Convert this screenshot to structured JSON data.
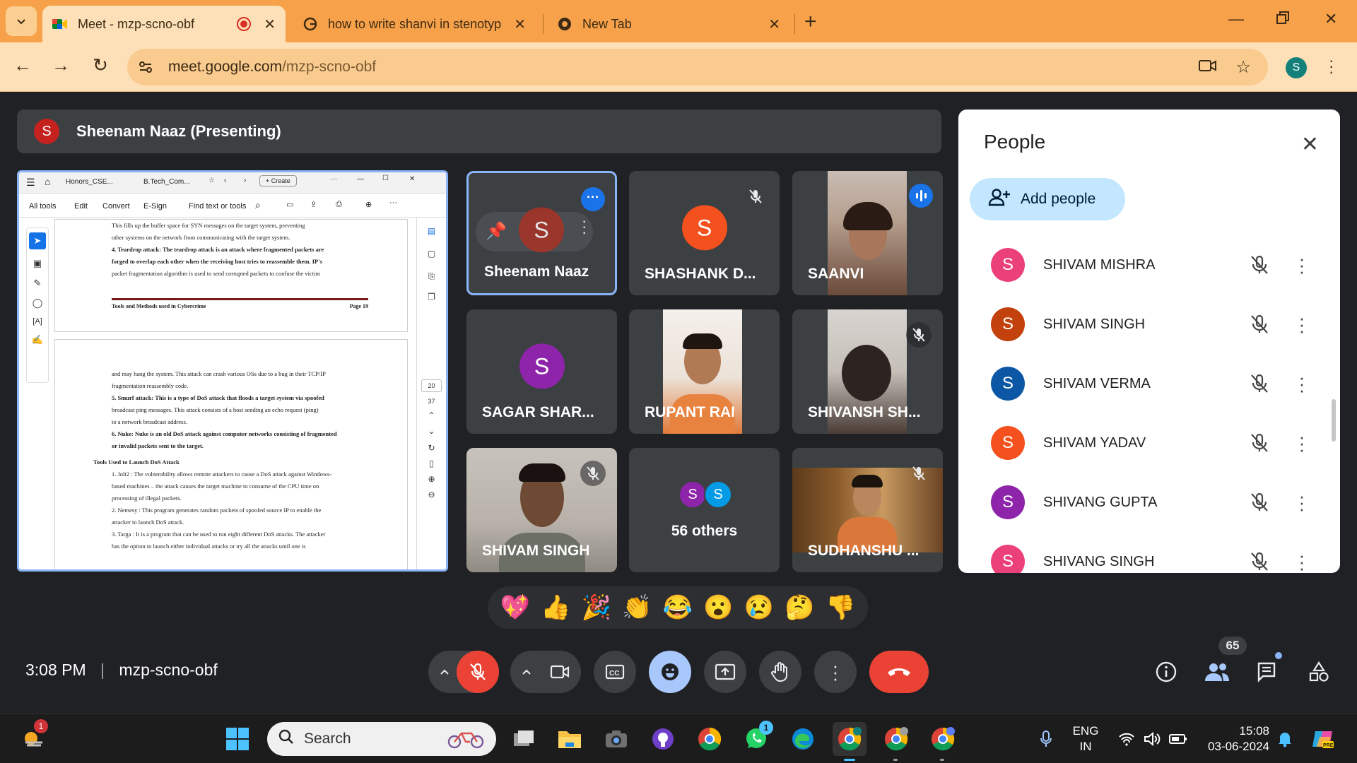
{
  "browser": {
    "tabs": [
      {
        "title": "Meet - mzp-scno-obf",
        "active": true,
        "icon": "meet-icon"
      },
      {
        "title": "how to write shanvi in stenotyp",
        "active": false,
        "icon": "google-icon"
      },
      {
        "title": "New Tab",
        "active": false,
        "icon": "chrome-icon"
      }
    ],
    "url_host": "meet.google.com",
    "url_path": "/mzp-scno-obf",
    "profile_initial": "S"
  },
  "presenter": {
    "initial": "S",
    "label": "Sheenam Naaz (Presenting)"
  },
  "presentation": {
    "tabs": [
      "Honors_CSE...",
      "B.Tech_Com...",
      "Create"
    ],
    "toolbar": [
      "All tools",
      "Edit",
      "Convert",
      "E-Sign",
      "Find text or tools"
    ],
    "page_top_lines": [
      "This fills up the buffer space for SYN messages on the target system, preventing",
      "other systems on the network from communicating with the target system.",
      "4. Teardrop attack: The teardrop attack is an attack where fragmented packets are",
      "forged to overlap each other when the receiving host tries to reassemble them. IP's",
      "packet fragmentation algorithm is used to send corrupted packets to confuse the victim"
    ],
    "footer_left": "Tools and Methods used in Cybercrime",
    "footer_right": "Page 19",
    "page_bottom_lines": [
      "and may hang the system. This attack can crash various OSs due to a bug in their TCP/IP",
      "fragmentation reassembly code.",
      "5. Smurf attack: This is a type of DoS attack that floods a target system via spoofed",
      "broadcast ping messages. This attack consists of a host sending an echo request (ping)",
      "to a network broadcast address.",
      "6. Nuke: Nuke is an old DoS attack against computer networks consisting of fragmented",
      "or invalid packets sent to the target.",
      "Tools Used to Launch DoS Attack",
      "1. Jolt2 : The vulnerability allows remote attackers to cause a DoS attack against Windows-",
      "based machines – the attack causes the target machine to consume of the CPU time on",
      "processing of illegal packets.",
      "2. Nemesy : This program generates random packets of spoofed source IP to enable the",
      "attacker to launch DoS attack.",
      "3. Targa : It is a program that can be used to run eight different DoS attacks. The attacker",
      "has the option to launch either individual attacks or try all the attacks until one is"
    ],
    "page_numbers": [
      "20",
      "37"
    ]
  },
  "tiles": [
    {
      "name": "Sheenam Naaz",
      "initial": "S",
      "color": "#a93226"
    },
    {
      "name": "SHASHANK D...",
      "initial": "S",
      "color": "#f4511e"
    },
    {
      "name": "SAANVI"
    },
    {
      "name": "SAGAR SHAR...",
      "initial": "S",
      "color": "#8e24aa"
    },
    {
      "name": "RUPANT RAI"
    },
    {
      "name": "SHIVANSH SH..."
    },
    {
      "name": "SHIVAM SINGH"
    },
    {
      "name": "56 others",
      "initials": [
        "S",
        "S"
      ]
    },
    {
      "name": "SUDHANSHU ..."
    }
  ],
  "people_panel": {
    "title": "People",
    "add_label": "Add people",
    "list": [
      {
        "name": "SHIVAM MISHRA",
        "initial": "S",
        "color": "#ec407a"
      },
      {
        "name": "SHIVAM SINGH",
        "initial": "S",
        "color": "#c2410c"
      },
      {
        "name": "SHIVAM VERMA",
        "initial": "S",
        "color": "#0b57a6"
      },
      {
        "name": "SHIVAM YADAV",
        "initial": "S",
        "color": "#f4511e"
      },
      {
        "name": "SHIVANG GUPTA",
        "initial": "S",
        "color": "#8e24aa"
      },
      {
        "name": "SHIVANG SINGH",
        "initial": "S",
        "color": "#ec407a"
      }
    ]
  },
  "reactions": [
    "💖",
    "👍",
    "🎉",
    "👏",
    "😂",
    "😮",
    "😢",
    "🤔",
    "👎"
  ],
  "controls": {
    "time": "3:08 PM",
    "separator": "|",
    "meeting_code": "mzp-scno-obf",
    "participant_count": "65"
  },
  "taskbar": {
    "search_placeholder": "Search",
    "lang_top": "ENG",
    "lang_bottom": "IN",
    "time": "15:08",
    "date": "03-06-2024",
    "weather_badge": "1",
    "whatsapp_badge": "1"
  },
  "colors": {
    "tab_bar": "#f7a24a",
    "address_bar": "#fde0b8",
    "meet_bg": "#202124",
    "tile_bg": "#3c4043",
    "end_call": "#ea4335",
    "accent_blue": "#8ab4f8"
  }
}
